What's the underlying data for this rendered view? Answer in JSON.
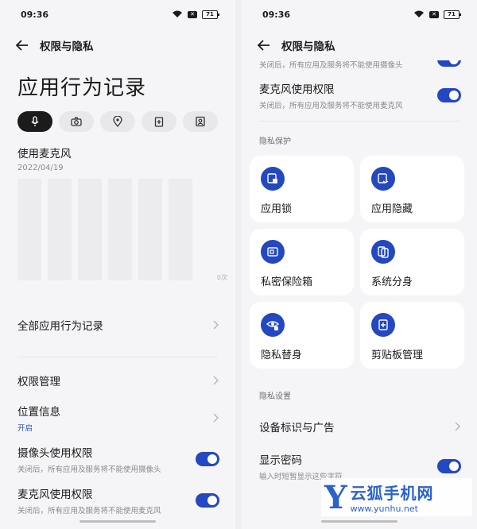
{
  "left": {
    "status_time": "09:36",
    "battery": "71",
    "nav_title": "权限与隐私",
    "big_title": "应用行为记录",
    "chips": [
      "microphone-icon",
      "camera-icon",
      "location-icon",
      "clipboard-icon",
      "contacts-icon"
    ],
    "section_title": "使用麦克风",
    "section_date": "2022/04/19",
    "chart_ylabel": "0次",
    "all_records": "全部应用行为记录",
    "perm_manage": "权限管理",
    "location_title": "位置信息",
    "location_sub": "开启",
    "camera_title": "摄像头使用权限",
    "camera_sub": "关闭后，所有应用及服务将不能使用摄像头",
    "mic_title": "麦克风使用权限",
    "mic_sub": "关闭后，所有应用及服务将不能使用麦克风"
  },
  "right": {
    "status_time": "09:36",
    "battery": "71",
    "nav_title": "权限与隐私",
    "camera_sub_partial": "关闭后，所有应用及服务将不能使用摄像头",
    "mic_title": "麦克风使用权限",
    "mic_sub": "关闭后，所有应用及服务将不能使用麦克风",
    "privacy_protect_label": "隐私保护",
    "cards": [
      {
        "label": "应用锁",
        "icon": "app-lock-icon"
      },
      {
        "label": "应用隐藏",
        "icon": "app-hide-icon"
      },
      {
        "label": "私密保险箱",
        "icon": "safe-box-icon"
      },
      {
        "label": "系统分身",
        "icon": "system-clone-icon"
      },
      {
        "label": "隐私替身",
        "icon": "privacy-mask-icon"
      },
      {
        "label": "剪贴板管理",
        "icon": "clipboard-manage-icon"
      }
    ],
    "privacy_settings_label": "隐私设置",
    "device_id_ads": "设备标识与广告",
    "show_password_title": "显示密码",
    "show_password_sub": "输入时短暂显示这些字符"
  },
  "watermark": {
    "brand": "云狐手机网",
    "url": "www.yunhu.net",
    "letter": "Y"
  },
  "colors": {
    "accent": "#2447c2",
    "chip_active": "#1b1b1b",
    "background": "#f5f5f7"
  }
}
